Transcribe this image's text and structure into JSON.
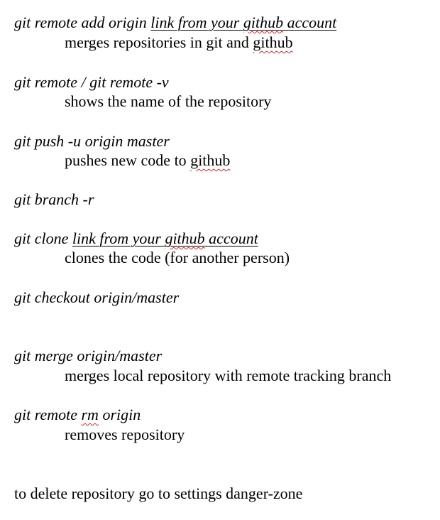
{
  "doc": {
    "l1_cmd": "git remote add origin ",
    "l1_link_a": "link from your ",
    "l1_link_b": "github",
    "l1_link_c": " account",
    "l1_desc_a": "merges repositories in git and ",
    "l1_desc_b": "github",
    "l2_cmd": "git remote / git remote -v",
    "l2_desc": "shows the name of the repository",
    "l3_cmd": "git push -u origin master",
    "l3_desc_a": "pushes new code to ",
    "l3_desc_b": "github",
    "l4_cmd": "git branch -r",
    "l5_cmd": "git clone ",
    "l5_link_a": "link from your ",
    "l5_link_b": "github",
    "l5_link_c": " account",
    "l5_desc": "clones the code (for another person)",
    "l6_cmd": "git checkout origin/master",
    "l7_cmd": "git merge origin/master",
    "l7_desc": "merges local repository with remote tracking branch",
    "l8_cmd_a": "git remote ",
    "l8_cmd_b": "rm",
    "l8_cmd_c": " origin",
    "l8_desc": "removes repository",
    "footer": "to delete repository go to settings danger-zone"
  }
}
